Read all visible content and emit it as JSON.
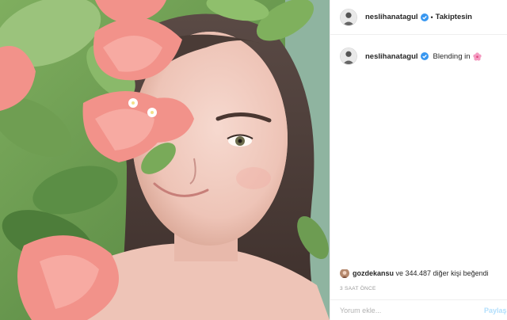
{
  "post": {
    "image": {
      "description_icon": "photo-icon"
    },
    "author": {
      "username": "neslihanatagul",
      "verified_icon": "verified-badge-icon",
      "separator": "•",
      "follow_state": "Takiptesin"
    },
    "caption": {
      "username": "neslihanatagul",
      "text": "Blending in",
      "emoji_icon": "cherry-blossom-emoji"
    },
    "likes": {
      "first_liker": "gozdekansu",
      "rest": " ve 344.487 diğer kişi beğendi"
    },
    "timestamp": "3 SAAT ÖNCE",
    "comment": {
      "placeholder": "Yorum ekle...",
      "share_label": "Paylaş"
    }
  },
  "colors": {
    "verified_blue": "#3897f0",
    "share_disabled": "#b2dffc",
    "muted": "#999999",
    "border": "#efefef"
  }
}
